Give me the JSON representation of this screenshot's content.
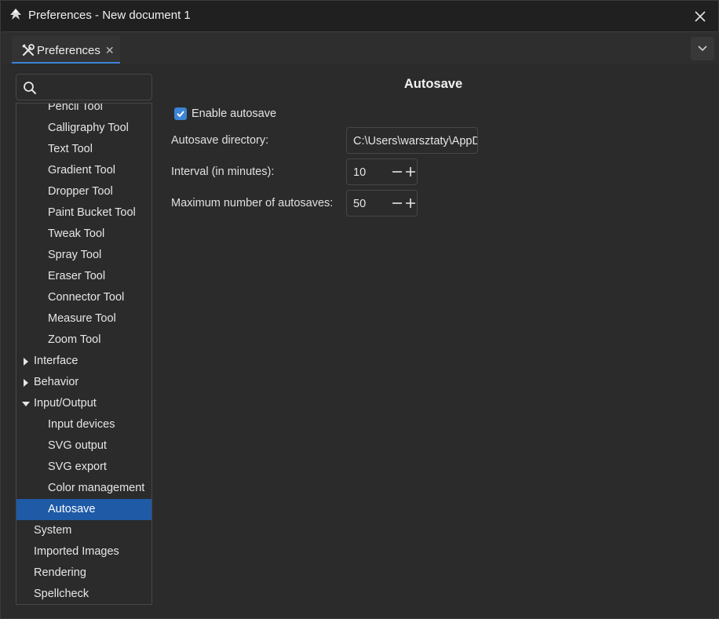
{
  "window": {
    "title": "Preferences - New document 1",
    "app_icon": "inkscape-icon",
    "close_icon": "close-icon"
  },
  "tabs": {
    "items": [
      {
        "label": "Preferences",
        "icon": "preferences-tools-icon",
        "close_glyph": "✕"
      }
    ],
    "menu_icon": "chevron-down-icon",
    "accent_color": "#3c84d6"
  },
  "sidebar": {
    "search": {
      "value": "",
      "placeholder": ""
    },
    "items": [
      {
        "label": "Pencil Tool",
        "level": 1
      },
      {
        "label": "Calligraphy Tool",
        "level": 1
      },
      {
        "label": "Text Tool",
        "level": 1
      },
      {
        "label": "Gradient Tool",
        "level": 1
      },
      {
        "label": "Dropper Tool",
        "level": 1
      },
      {
        "label": "Paint Bucket Tool",
        "level": 1
      },
      {
        "label": "Tweak Tool",
        "level": 1
      },
      {
        "label": "Spray Tool",
        "level": 1
      },
      {
        "label": "Eraser Tool",
        "level": 1
      },
      {
        "label": "Connector Tool",
        "level": 1
      },
      {
        "label": "Measure Tool",
        "level": 1
      },
      {
        "label": "Zoom Tool",
        "level": 1
      },
      {
        "label": "Interface",
        "level": 0,
        "expander": "collapsed"
      },
      {
        "label": "Behavior",
        "level": 0,
        "expander": "collapsed"
      },
      {
        "label": "Input/Output",
        "level": 0,
        "expander": "expanded"
      },
      {
        "label": "Input devices",
        "level": 1
      },
      {
        "label": "SVG output",
        "level": 1
      },
      {
        "label": "SVG export",
        "level": 1
      },
      {
        "label": "Color management",
        "level": 1
      },
      {
        "label": "Autosave",
        "level": 1,
        "selected": true
      },
      {
        "label": "System",
        "level": 0
      },
      {
        "label": "Imported Images",
        "level": 0
      },
      {
        "label": "Rendering",
        "level": 0
      },
      {
        "label": "Spellcheck",
        "level": 0
      }
    ],
    "selection_color": "#1e5aa6"
  },
  "panel": {
    "title": "Autosave",
    "enable": {
      "label": "Enable autosave",
      "checked": true
    },
    "directory": {
      "label": "Autosave directory:",
      "value": "C:\\Users\\warsztaty\\AppData\\Local\\Temp"
    },
    "interval": {
      "label": "Interval (in minutes):",
      "value": "10"
    },
    "max_autosaves": {
      "label": "Maximum number of autosaves:",
      "value": "50"
    }
  }
}
